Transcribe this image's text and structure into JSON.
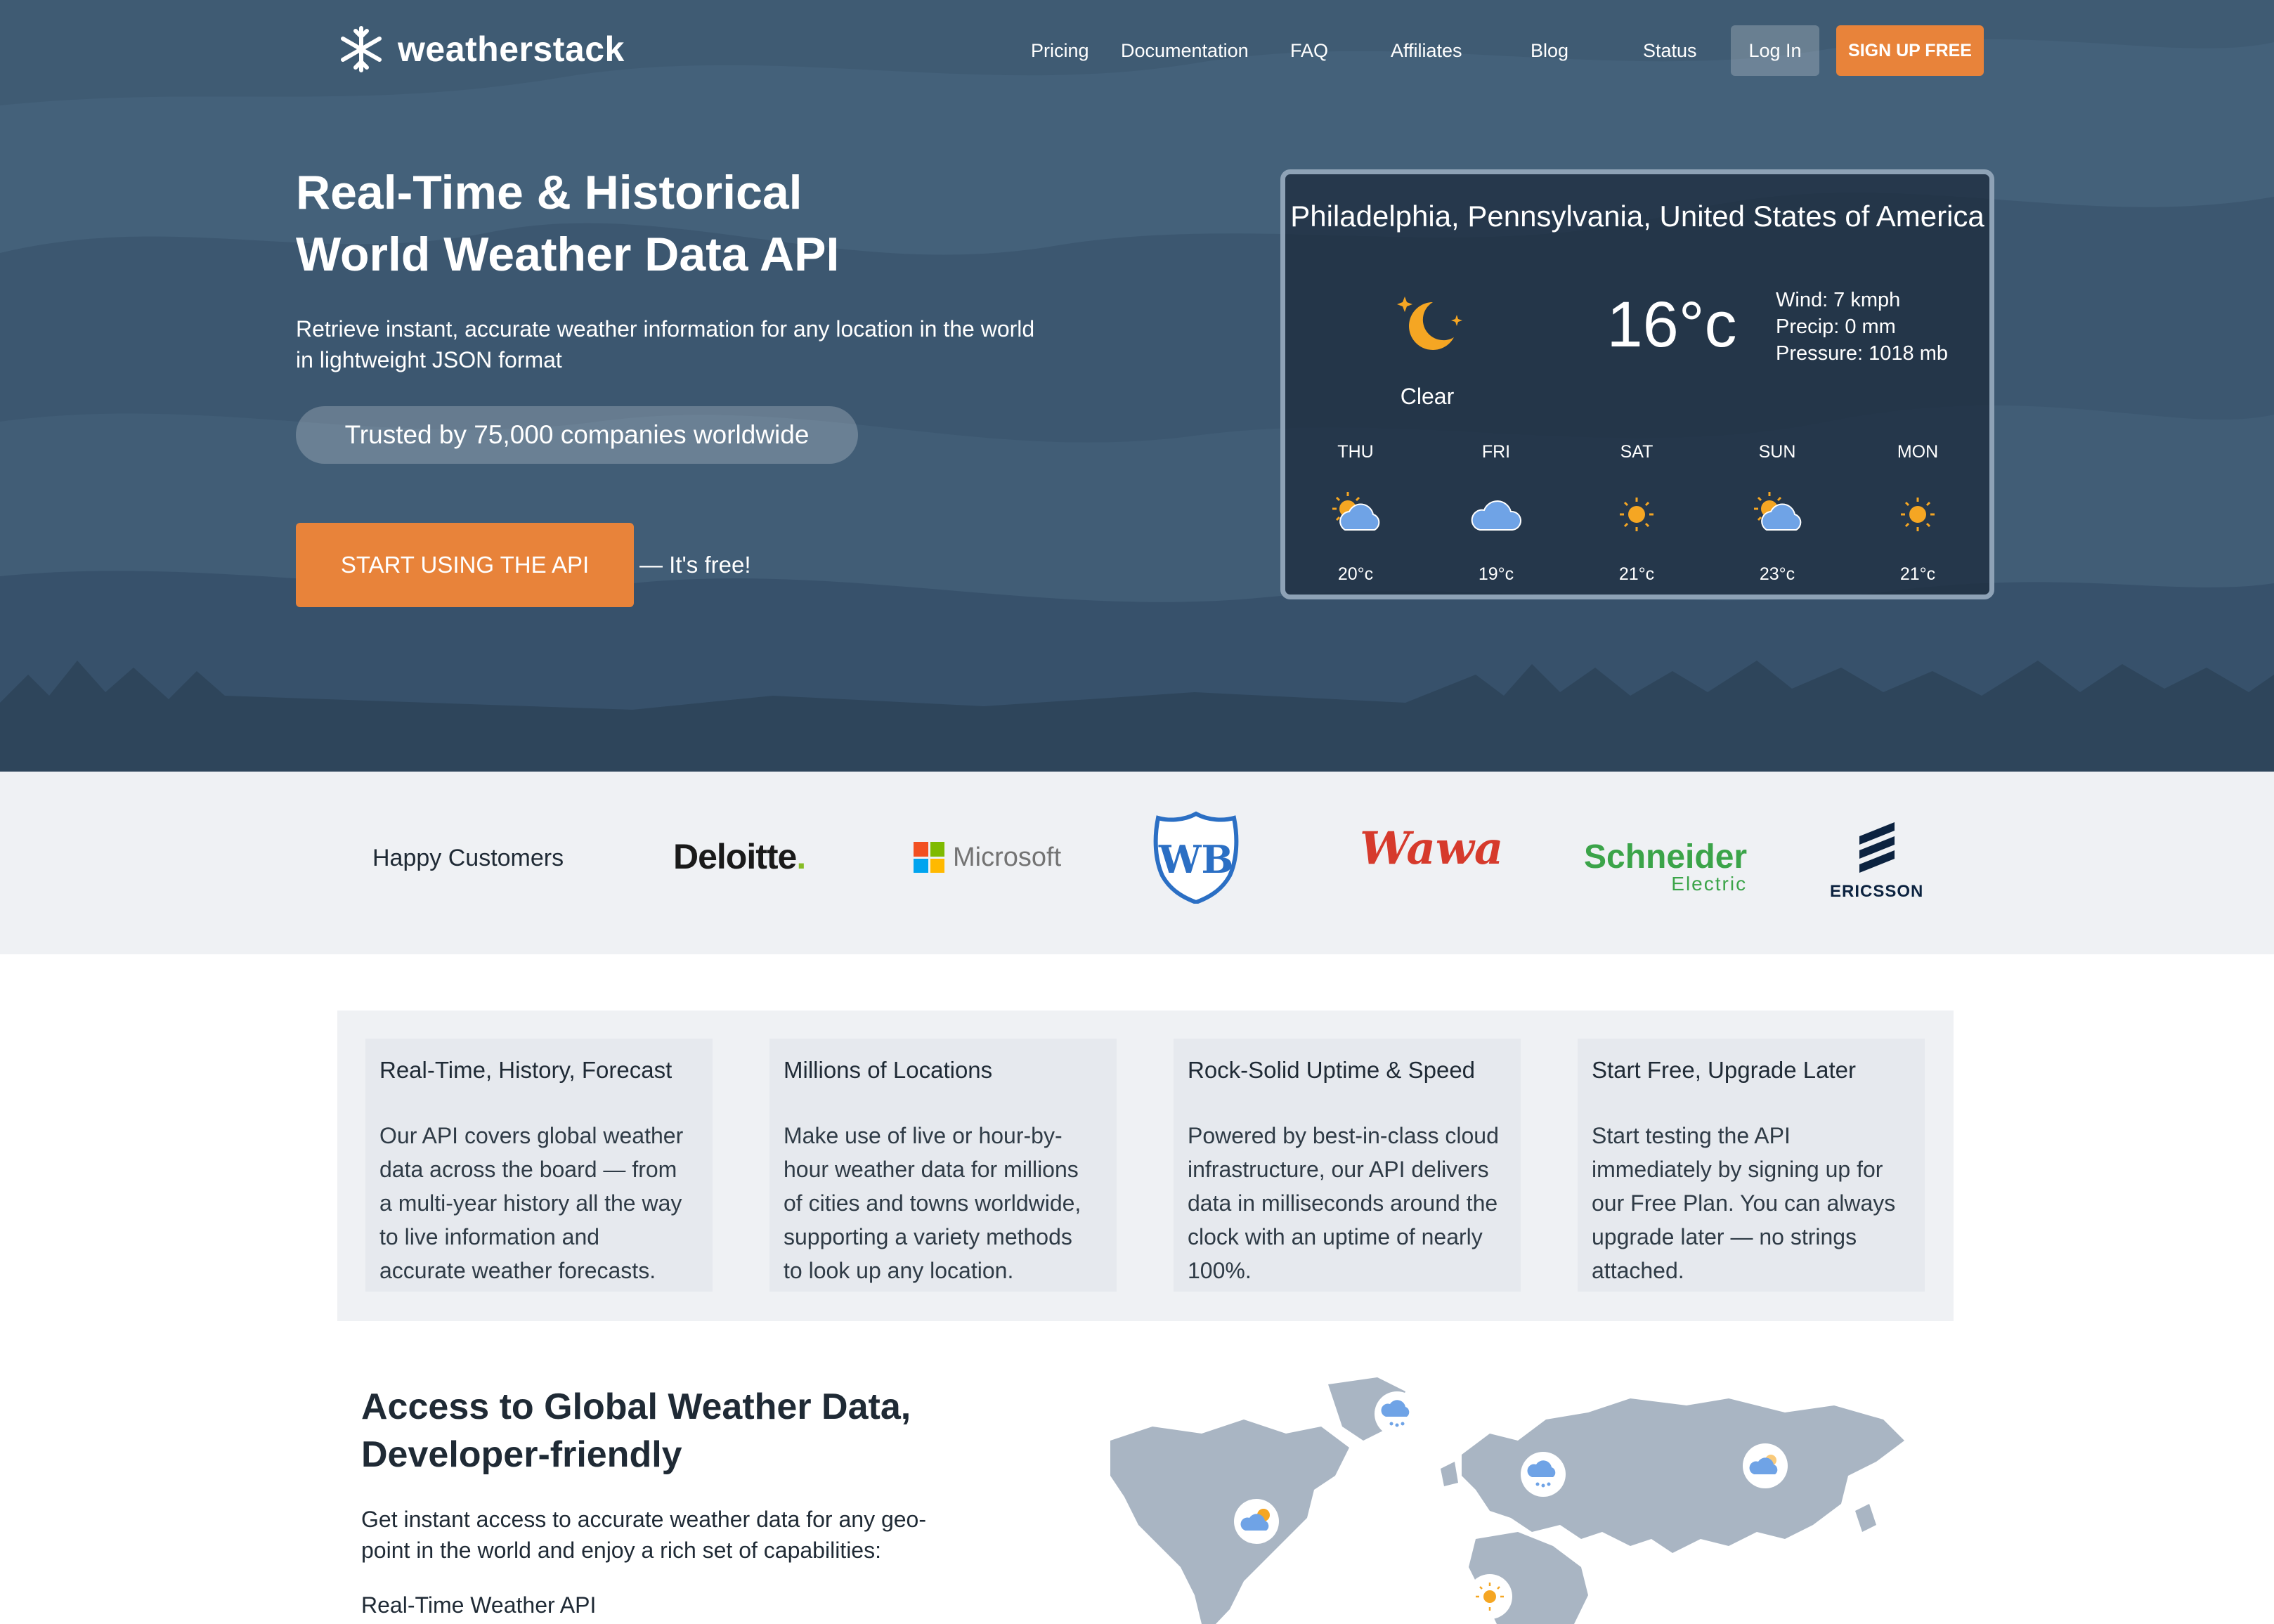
{
  "brand": {
    "name": "weatherstack"
  },
  "nav": {
    "links": [
      "Pricing",
      "Documentation",
      "FAQ",
      "Affiliates",
      "Blog",
      "Status"
    ],
    "login": "Log In",
    "signup": "SIGN UP FREE"
  },
  "hero": {
    "title_line1": "Real-Time & Historical",
    "title_line2": "World Weather Data API",
    "subtitle_line1": "Retrieve instant, accurate weather information for any location in the world",
    "subtitle_line2": "in lightweight JSON format",
    "trusted": "Trusted by 75,000 companies worldwide",
    "cta": "START USING THE API",
    "cta_note": "— It's free!"
  },
  "widget": {
    "location": "Philadelphia, Pennsylvania, United States of America",
    "condition": "Clear",
    "temperature": "16°c",
    "wind": "Wind: 7 kmph",
    "precip": "Precip: 0 mm",
    "pressure": "Pressure: 1018 mb",
    "forecast": [
      {
        "day": "THU",
        "temp": "20°c",
        "icon": "partly-cloudy-icon"
      },
      {
        "day": "FRI",
        "temp": "19°c",
        "icon": "cloud-icon"
      },
      {
        "day": "SAT",
        "temp": "21°c",
        "icon": "sun-icon"
      },
      {
        "day": "SUN",
        "temp": "23°c",
        "icon": "partly-cloudy-icon"
      },
      {
        "day": "MON",
        "temp": "21°c",
        "icon": "sun-icon"
      }
    ]
  },
  "customers": {
    "label": "Happy Customers",
    "logos": {
      "deloitte": "Deloitte",
      "deloitte_dot": ".",
      "microsoft": "Microsoft",
      "wb": "WB",
      "wawa": "Wawa",
      "schneider_1": "Schneider",
      "schneider_2": "Electric",
      "ericsson": "ERICSSON"
    }
  },
  "features": [
    {
      "title": "Real-Time, History, Forecast",
      "text": [
        "Our API covers global weather",
        "data across the board — from",
        "a multi-year history all the way",
        "to live information and",
        "accurate weather forecasts."
      ]
    },
    {
      "title": "Millions of Locations",
      "text": [
        "Make use of live or hour-by-",
        "hour weather data for millions",
        "of cities and towns worldwide,",
        "supporting a variety methods",
        "to look up any location."
      ]
    },
    {
      "title": "Rock-Solid Uptime & Speed",
      "text": [
        "Powered by best-in-class cloud",
        "infrastructure, our API delivers",
        "data in milliseconds around the",
        "clock with an uptime of nearly",
        "100%."
      ]
    },
    {
      "title": "Start Free, Upgrade Later",
      "text": [
        "Start testing the API",
        "immediately by signing up for",
        "our Free Plan. You can always",
        "upgrade later — no strings",
        "attached."
      ]
    }
  ],
  "access": {
    "title_line1": "Access to Global Weather Data,",
    "title_line2": "Developer-friendly",
    "text_line1": "Get instant access to accurate weather data for any geo-",
    "text_line2": "point in the world and enjoy a rich set of capabilities:",
    "sub": "Real-Time Weather API"
  },
  "colors": {
    "hero_bg": "#3e5a72",
    "accent": "#e8833a",
    "widget_border": "#8ea2b6",
    "sun": "#f5a623",
    "cloud": "#6fa3e6",
    "map": "#a9b5c3"
  }
}
